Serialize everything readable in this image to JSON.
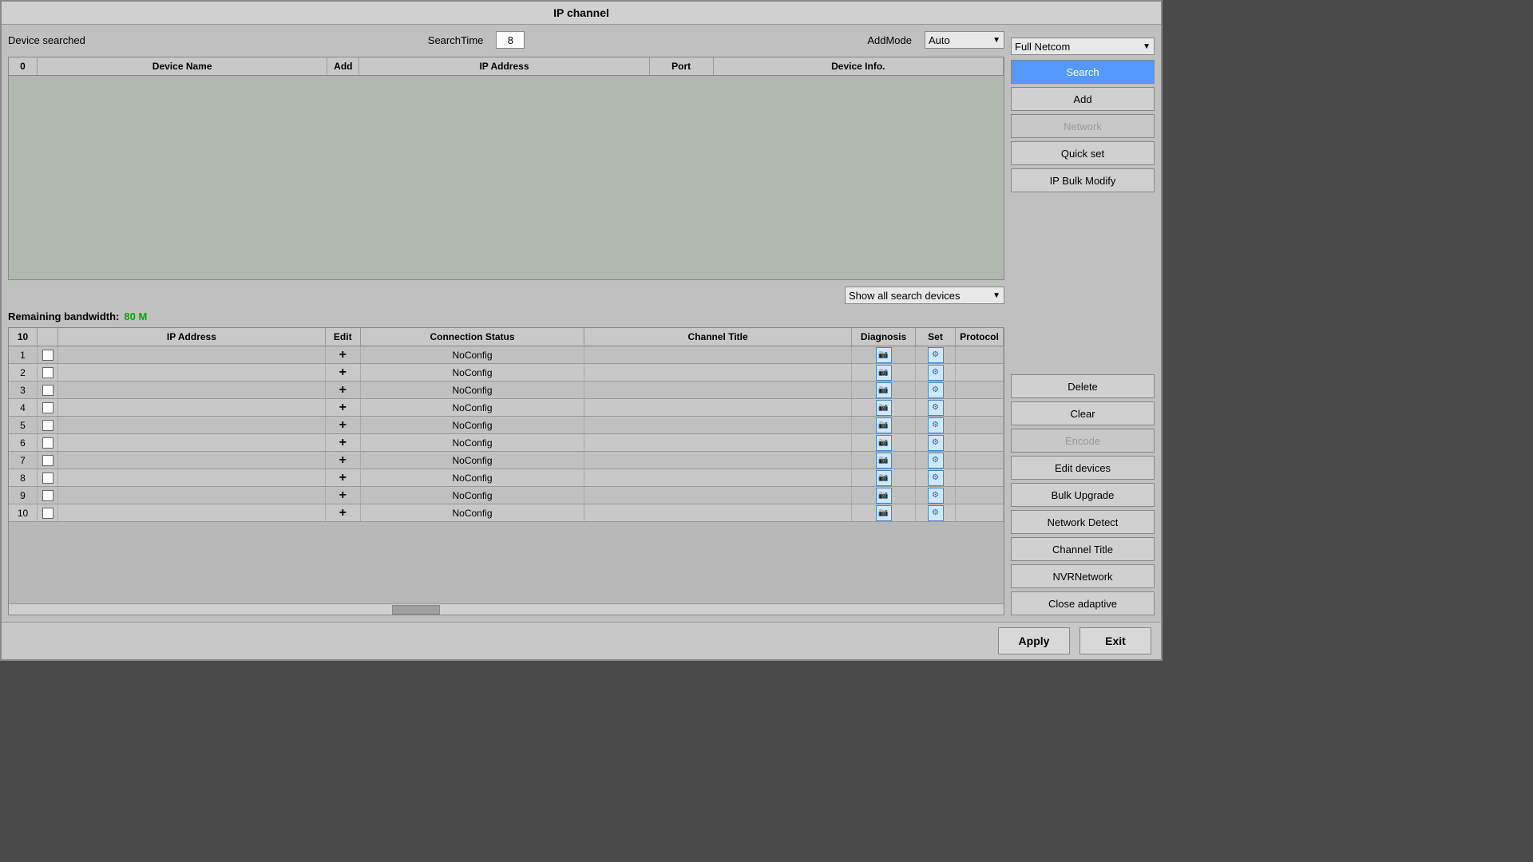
{
  "window": {
    "title": "IP channel"
  },
  "top_section": {
    "device_searched_label": "Device searched",
    "search_time_label": "SearchTime",
    "search_time_value": "8",
    "add_mode_label": "AddMode",
    "add_mode_value": "Auto",
    "full_netcom_label": "Full Netcom",
    "search_button": "Search",
    "add_button": "Add",
    "network_button": "Network",
    "quick_set_button": "Quick set",
    "ip_bulk_modify_button": "IP Bulk Modify"
  },
  "device_table": {
    "columns": [
      "0",
      "Device Name",
      "Add",
      "IP Address",
      "Port",
      "Device Info."
    ]
  },
  "show_all_label": "Show all search devices",
  "bandwidth": {
    "label": "Remaining bandwidth:",
    "value": "80 M"
  },
  "channel_table": {
    "columns": [
      "10",
      "",
      "IP Address",
      "Edit",
      "Connection Status",
      "Channel Title",
      "Diagnosis",
      "Set",
      "Protocol"
    ],
    "rows": [
      {
        "num": "1",
        "ip": "",
        "status": "NoConfig"
      },
      {
        "num": "2",
        "ip": "",
        "status": "NoConfig"
      },
      {
        "num": "3",
        "ip": "",
        "status": "NoConfig"
      },
      {
        "num": "4",
        "ip": "",
        "status": "NoConfig"
      },
      {
        "num": "5",
        "ip": "",
        "status": "NoConfig"
      },
      {
        "num": "6",
        "ip": "",
        "status": "NoConfig"
      },
      {
        "num": "7",
        "ip": "",
        "status": "NoConfig"
      },
      {
        "num": "8",
        "ip": "",
        "status": "NoConfig"
      },
      {
        "num": "9",
        "ip": "",
        "status": "NoConfig"
      },
      {
        "num": "10",
        "ip": "",
        "status": "NoConfig"
      }
    ]
  },
  "right_buttons": {
    "delete": "Delete",
    "clear": "Clear",
    "encode": "Encode",
    "edit_devices": "Edit devices",
    "bulk_upgrade": "Bulk Upgrade",
    "network_detect": "Network Detect",
    "channel_title": "Channel Title",
    "nvr_network": "NVRNetwork",
    "close_adaptive": "Close adaptive"
  },
  "bottom_buttons": {
    "apply": "Apply",
    "exit": "Exit"
  }
}
